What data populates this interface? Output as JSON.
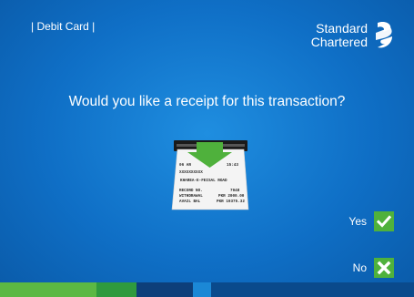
{
  "header": {
    "card_type_label": "| Debit Card |",
    "brand_line1": "Standard",
    "brand_line2": "Chartered"
  },
  "prompt": {
    "question": "Would you like a receipt for this transaction?"
  },
  "receipt_illustration": {
    "lines": [
      [
        "06 AR",
        "15:43"
      ],
      [
        "",
        "XXXXXXXXXX"
      ],
      [
        "KHAREA-E-FEISAL ROAD",
        ""
      ],
      [
        "RECORD NO.",
        "7048"
      ],
      [
        "WITHDRAWAL",
        "PKR 2000.00"
      ],
      [
        "AVAIL BAL",
        "PKR 19375.32"
      ]
    ]
  },
  "options": {
    "yes_label": "Yes",
    "no_label": "No"
  },
  "icons": {
    "yes": "checkmark-icon",
    "no": "x-icon",
    "brand": "standard-chartered-logo-icon",
    "receipt": "receipt-dispense-icon"
  },
  "colors": {
    "background": "#0f6fc6",
    "accent_green": "#4fb13c",
    "bar_green_light": "#5cb843",
    "bar_green": "#2f9a3e",
    "bar_navy": "#0d3f7a",
    "bar_blue": "#1b88d6",
    "bar_dark_blue": "#0a4a8c"
  }
}
